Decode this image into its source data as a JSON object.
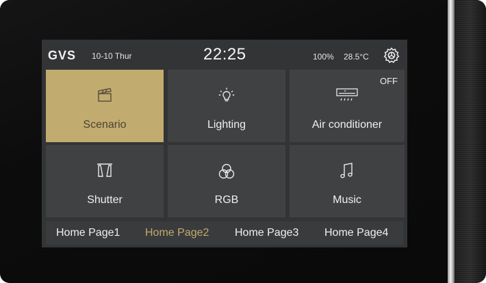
{
  "status": {
    "logo": "GVS",
    "date": "10-10 Thur",
    "time": "22:25",
    "brightness": "100%",
    "temperature": "28.5°C",
    "settings_icon": "gear-icon"
  },
  "tiles": [
    {
      "label": "Scenario",
      "icon": "clapperboard-icon",
      "active": true
    },
    {
      "label": "Lighting",
      "icon": "lightbulb-icon",
      "active": false
    },
    {
      "label": "Air conditioner",
      "icon": "air-conditioner-icon",
      "active": false,
      "badge": "OFF"
    },
    {
      "label": "Shutter",
      "icon": "curtain-icon",
      "active": false
    },
    {
      "label": "RGB",
      "icon": "rgb-circles-icon",
      "active": false
    },
    {
      "label": "Music",
      "icon": "music-note-icon",
      "active": false
    }
  ],
  "nav": {
    "pages": [
      "Home Page1",
      "Home Page2",
      "Home Page3",
      "Home Page4"
    ],
    "active_index": 1
  },
  "colors": {
    "accent_gold": "#c2ab6e",
    "tile_bg": "#404143",
    "screen_bg": "#333436"
  }
}
